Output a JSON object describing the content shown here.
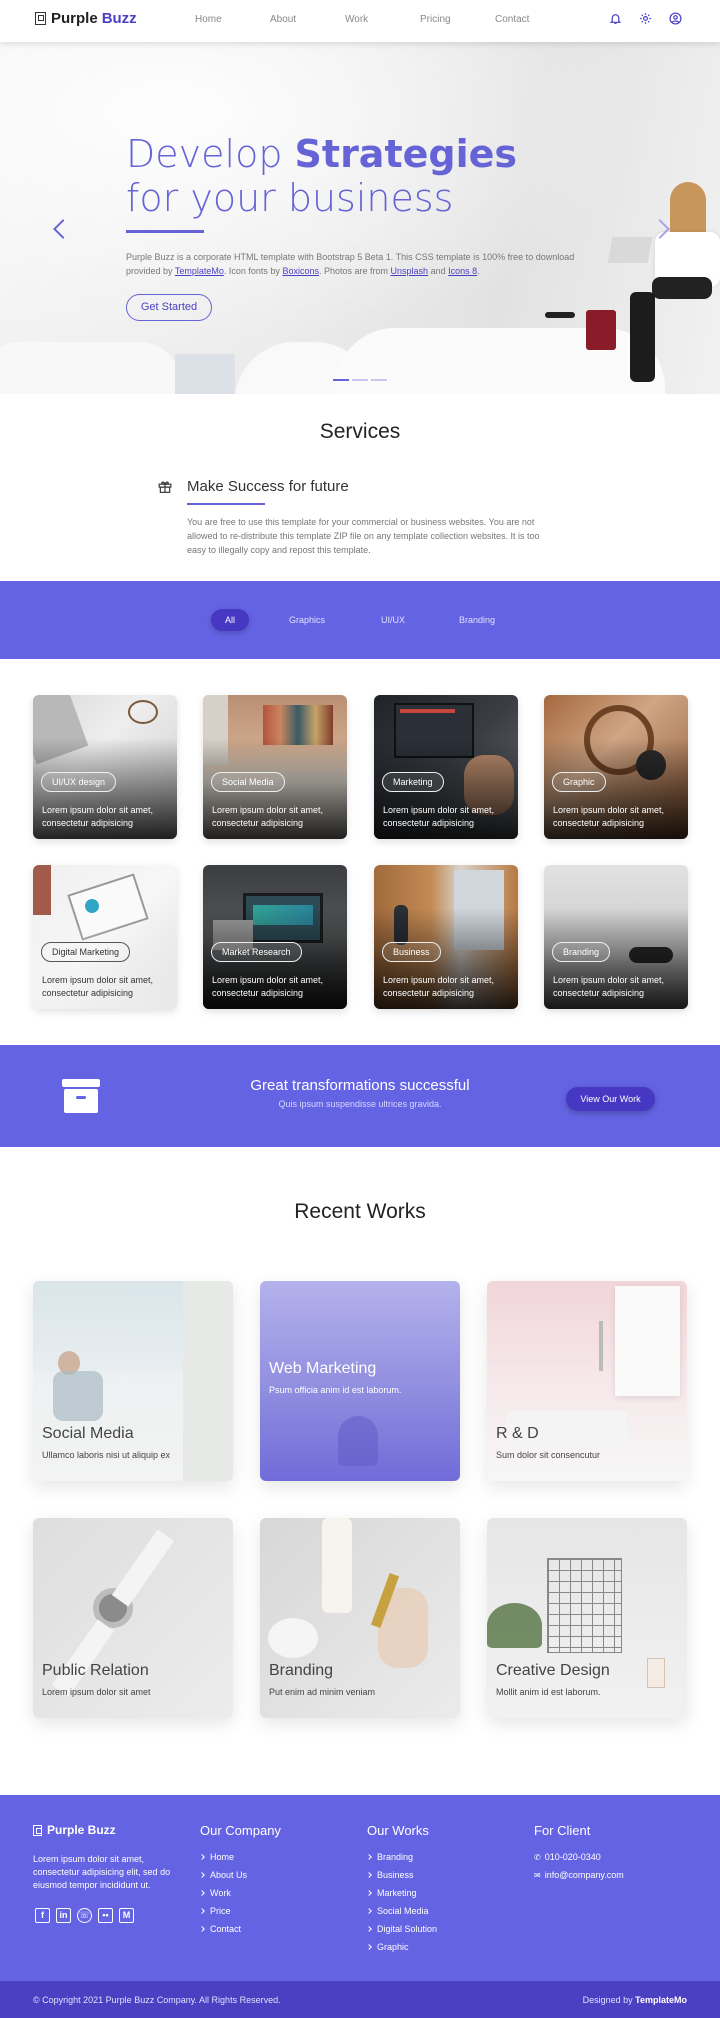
{
  "nav": {
    "brand_part1": "Purple",
    "brand_part2": "Buzz",
    "links": [
      "Home",
      "About",
      "Work",
      "Pricing",
      "Contact"
    ],
    "icons": [
      "bell-icon",
      "gear-icon",
      "user-circle-icon"
    ]
  },
  "hero": {
    "title_part1": "Develop",
    "title_strong": "Strategies",
    "title_part2": "for your business",
    "desc_text1": "Purple Buzz is a corporate HTML template with Bootstrap 5 Beta 1. This CSS template is 100% free to download provided by",
    "desc_link1": "TemplateMo",
    "desc_text2": ". Icon fonts by",
    "desc_link2": "Boxicons",
    "desc_text3": ". Photos are from",
    "desc_link3": "Unsplash",
    "desc_text4": "and",
    "desc_link4": "Icons 8",
    "desc_text5": ".",
    "button": "Get Started",
    "active_slide": 1,
    "slide_count": 3
  },
  "services": {
    "title": "Services",
    "feature_title": "Make Success for future",
    "feature_desc": "You are free to use this template for your commercial or business websites. You are not allowed to re-distribute this template ZIP file on any template collection websites. It is too easy to illegally copy and repost this template."
  },
  "filters": {
    "tabs": [
      "All",
      "Graphics",
      "UI/UX",
      "Branding"
    ],
    "active": "All"
  },
  "cards": [
    {
      "badge": "UI/UX design",
      "text": "Lorem ipsum dolor sit amet, consectetur adipisicing"
    },
    {
      "badge": "Social Media",
      "text": "Lorem ipsum dolor sit amet, consectetur adipisicing"
    },
    {
      "badge": "Marketing",
      "text": "Lorem ipsum dolor sit amet, consectetur adipisicing"
    },
    {
      "badge": "Graphic",
      "text": "Lorem ipsum dolor sit amet, consectetur adipisicing"
    },
    {
      "badge": "Digital Marketing",
      "text": "Lorem ipsum dolor sit amet, consectetur adipisicing"
    },
    {
      "badge": "Market Research",
      "text": "Lorem ipsum dolor sit amet, consectetur adipisicing"
    },
    {
      "badge": "Business",
      "text": "Lorem ipsum dolor sit amet, consectetur adipisicing"
    },
    {
      "badge": "Branding",
      "text": "Lorem ipsum dolor sit amet, consectetur adipisicing"
    }
  ],
  "banner": {
    "title": "Great transformations successful",
    "subtitle": "Quis ipsum suspendisse ultrices gravida.",
    "button": "View Our Work"
  },
  "recent_works": {
    "title": "Recent Works",
    "items": [
      {
        "title": "Social Media",
        "subtitle": "Ullamco laboris nisi ut aliquip ex"
      },
      {
        "title": "Web Marketing",
        "subtitle": "Psum officia anim id est laborum."
      },
      {
        "title": "R & D",
        "subtitle": "Sum dolor sit consencutur"
      },
      {
        "title": "Public Relation",
        "subtitle": "Lorem ipsum dolor sit amet"
      },
      {
        "title": "Branding",
        "subtitle": "Put enim ad minim veniam"
      },
      {
        "title": "Creative Design",
        "subtitle": "Mollit anim id est laborum."
      }
    ]
  },
  "footer": {
    "brand": "Purple Buzz",
    "desc": "Lorem ipsum dolor sit amet, consectetur adipisicing elit, sed do eiusmod tempor incididunt ut.",
    "socials": [
      "facebook-icon",
      "linkedin-icon",
      "whatsapp-icon",
      "flickr-icon",
      "medium-icon"
    ],
    "company_title": "Our Company",
    "company_links": [
      "Home",
      "About Us",
      "Work",
      "Price",
      "Contact"
    ],
    "works_title": "Our Works",
    "works_links": [
      "Branding",
      "Business",
      "Marketing",
      "Social Media",
      "Digital Solution",
      "Graphic"
    ],
    "client_title": "For Client",
    "client_phone": "010-020-0340",
    "client_email": "info@company.com",
    "copyright": "© Copyright 2021 Purple Buzz Company. All Rights Reserved.",
    "designed_by": "Designed by",
    "designer": "TemplateMo"
  },
  "colors": {
    "primary": "#6463e3",
    "primary_dark": "#4b3fc2",
    "accent_text": "#6563d6"
  }
}
